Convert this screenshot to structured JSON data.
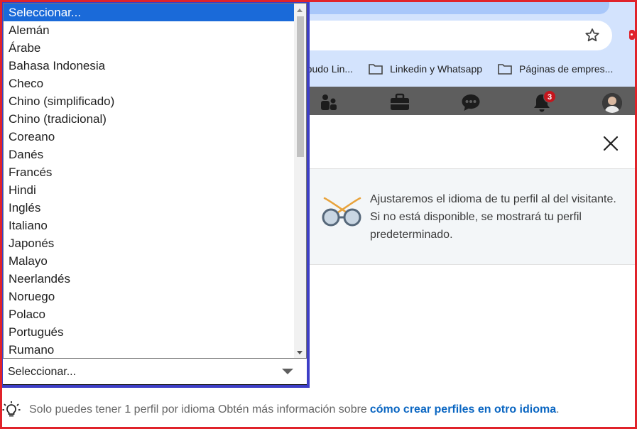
{
  "browser": {
    "bookmarks": [
      {
        "label": "mbudo Lin...",
        "icon": "folder-icon"
      },
      {
        "label": "Linkedin y Whatsapp",
        "icon": "folder-icon"
      },
      {
        "label": "Páginas de empres...",
        "icon": "folder-icon"
      }
    ]
  },
  "nav": {
    "notification_count": "3",
    "icons": [
      "my-network-icon",
      "jobs-icon",
      "messaging-icon",
      "notifications-icon",
      "profile-avatar"
    ]
  },
  "modal": {
    "info_text": "Ajustaremos el idioma de tu perfil al del visitante. Si no está disponible, se mostrará tu perfil predeterminado.",
    "hint_text": "Solo puedes tener 1 perfil por idioma Obtén más información sobre",
    "hint_link": "cómo crear perfiles en otro idioma",
    "hint_period": "."
  },
  "language_select": {
    "value": "Seleccionar...",
    "options": [
      "Seleccionar...",
      "Alemán",
      "Árabe",
      "Bahasa Indonesia",
      "Checo",
      "Chino (simplificado)",
      "Chino (tradicional)",
      "Coreano",
      "Danés",
      "Francés",
      "Hindi",
      "Inglés",
      "Italiano",
      "Japonés",
      "Malayo",
      "Neerlandés",
      "Noruego",
      "Polaco",
      "Portugués",
      "Rumano"
    ],
    "highlighted_index": 0
  },
  "colors": {
    "highlight": "#1a6ad9",
    "frame_red": "#e0232a",
    "select_border": "#3d3ec6",
    "link": "#0a66c2"
  }
}
